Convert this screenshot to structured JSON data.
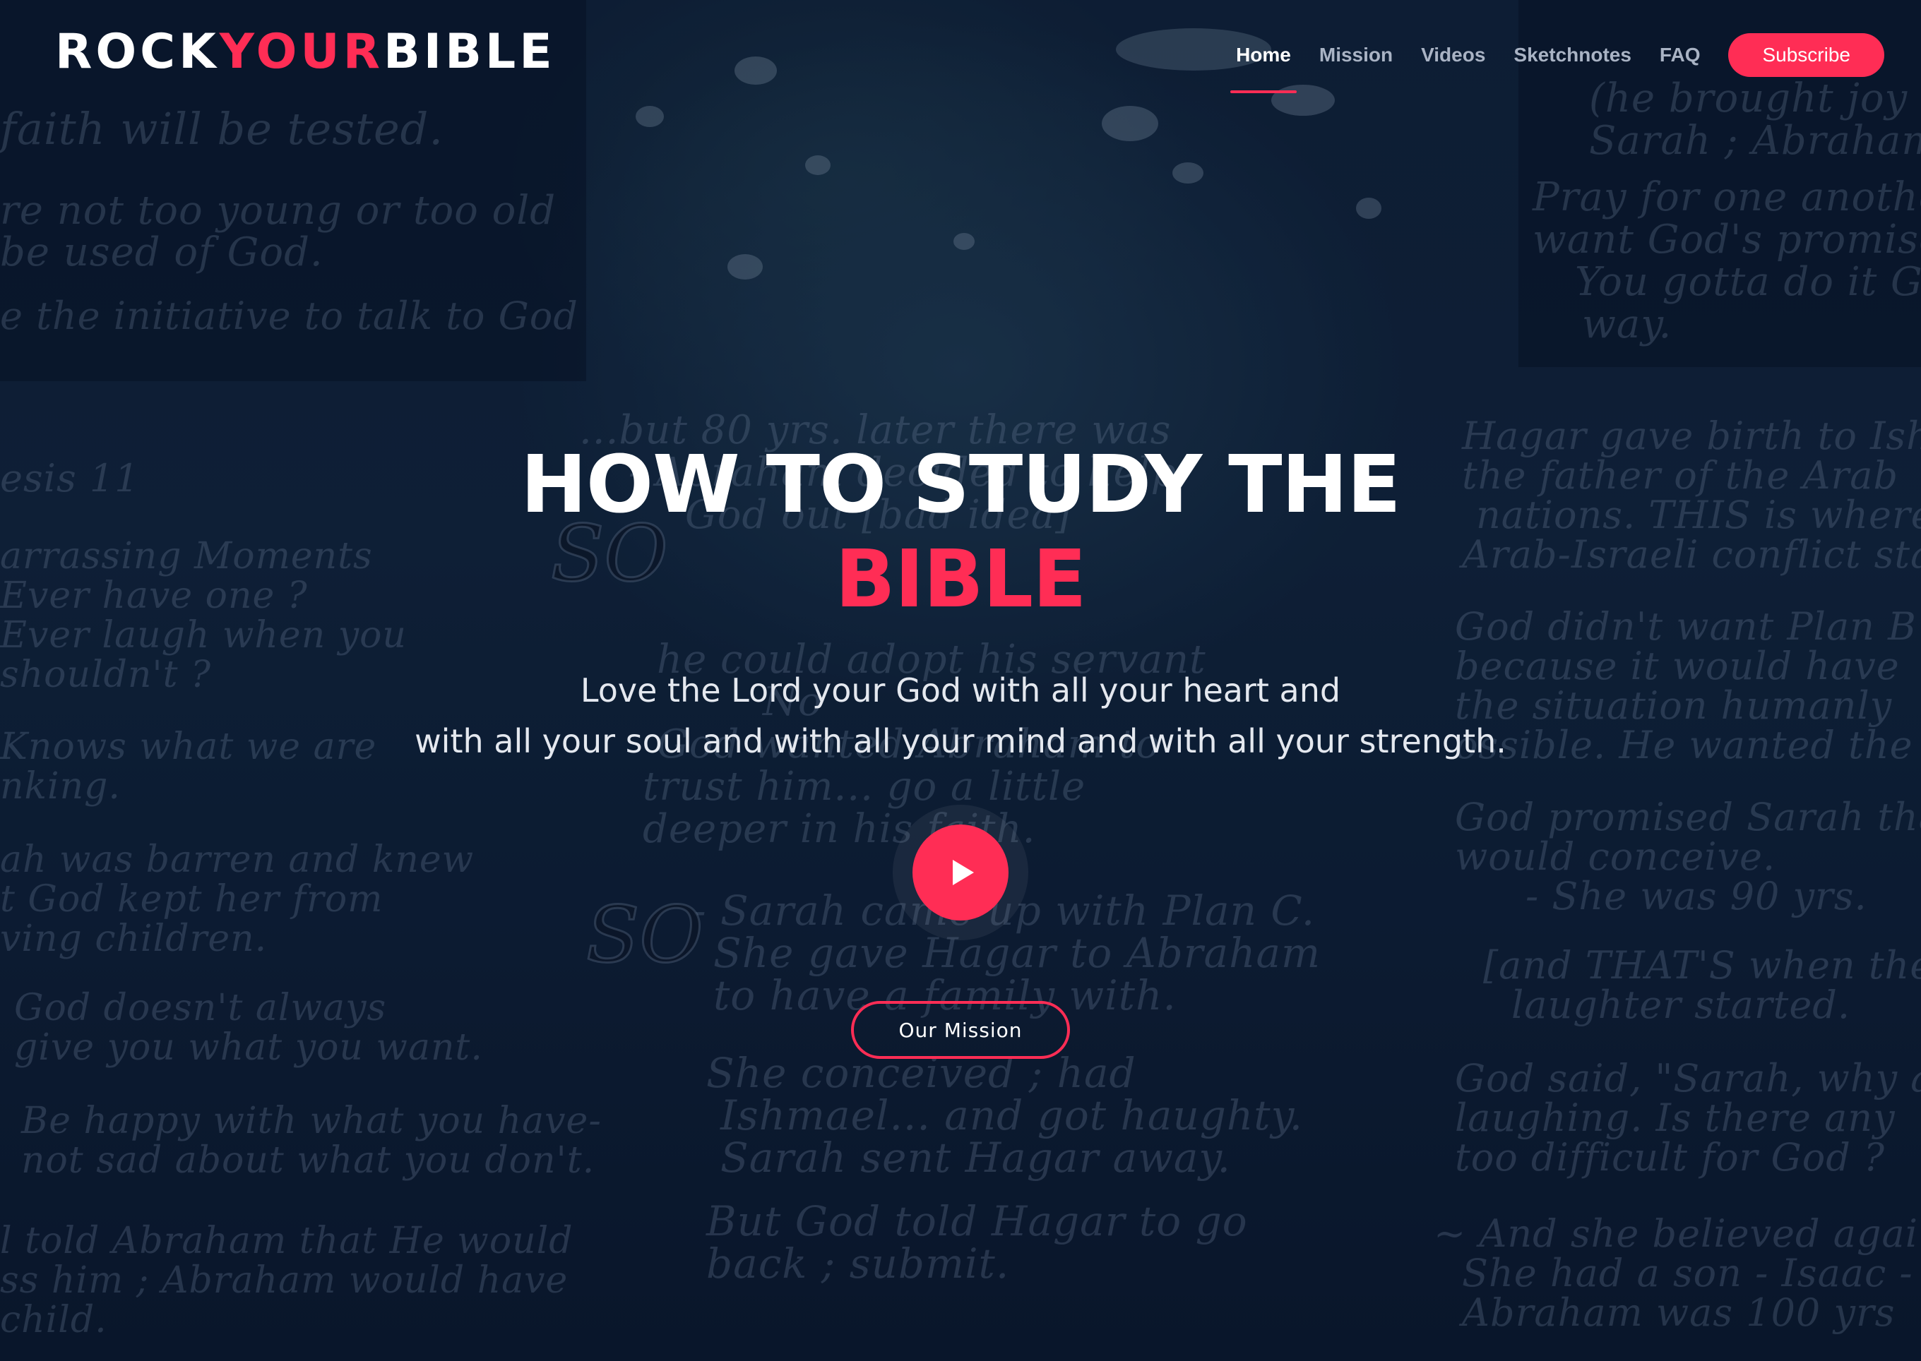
{
  "brand": {
    "part1": "ROCK",
    "part2": "YOUR",
    "part3": "BIBLE",
    "accent_color": "#ff2d55"
  },
  "nav": {
    "items": [
      {
        "label": "Home",
        "active": true
      },
      {
        "label": "Mission",
        "active": false
      },
      {
        "label": "Videos",
        "active": false
      },
      {
        "label": "Sketchnotes",
        "active": false
      },
      {
        "label": "FAQ",
        "active": false
      }
    ],
    "subscribe_label": "Subscribe"
  },
  "hero": {
    "title_line1": "HOW TO STUDY THE",
    "title_line2": "BIBLE",
    "subtitle_line1": "Love the Lord your God with all your heart and",
    "subtitle_line2": "with all your soul and with all your mind and with all your strength.",
    "mission_button_label": "Our Mission",
    "play_icon": "play-icon"
  },
  "background": {
    "left_notes": [
      "faith will be tested.",
      "re not too young or too old",
      "be used of God.",
      "e the initiative to talk to God",
      "esis 11",
      "arrassing Moments",
      "Ever have one ?",
      "Ever laugh when you",
      "shouldn't ?",
      "Knows what we are",
      "nking.",
      "ah was barren and knew",
      "t God kept her from",
      "ving children.",
      "God doesn't always",
      "give you what you want.",
      "Be happy with what you have-",
      "not sad about what you don't.",
      "l told Abraham that He would",
      "ss him ; Abraham would have",
      "child."
    ],
    "center_notes": [
      "...but 80 yrs. later there was",
      "- Abraham decided to help",
      "God out [bad idea]",
      "he could adopt his servant",
      "No",
      "God wanted Abraham to",
      "trust him... go a little",
      "deeper in his faith.",
      "- Sarah came up with Plan C.",
      "She gave Hagar to Abraham",
      "to have a family with.",
      "She conceived ; had",
      "Ishmael... and got haughty.",
      "Sarah sent Hagar away.",
      "But God told Hagar to go",
      "back ; submit."
    ],
    "right_notes": [
      "(he brought joy",
      "Sarah ; Abraham",
      "Pray for one another",
      "want God's promise",
      "You gotta do it Go",
      "way.",
      "Hagar gave birth to Ishm",
      "the father of the Arab",
      "nations. THIS is where",
      "Arab-Israeli conflict sta",
      "God didn't want Plan B",
      "because it would have",
      "the situation humanly",
      "ossible. He wanted the",
      "God promised Sarah that",
      "would conceive.",
      "- She was 90 yrs.",
      "[and THAT'S when the",
      "laughter started.",
      "God said, \"Sarah, why a",
      "laughing. Is there any",
      "too difficult for God ?",
      "~ And she believed agai",
      "She had a son - Isaac - w",
      "Abraham was 100 yrs"
    ],
    "so_marks": [
      "SO",
      "SO"
    ]
  }
}
